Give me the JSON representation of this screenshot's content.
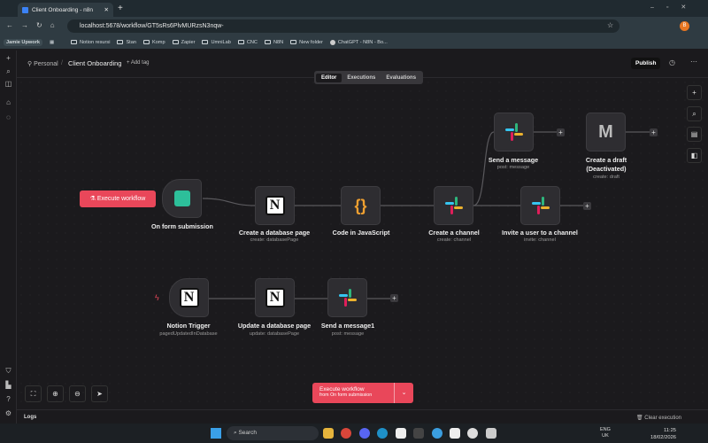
{
  "browser": {
    "tab_title": "Client Onboarding - n8n",
    "url": "localhost:5678/workflow/GT5sRs6PlvMURzsN3nqw-",
    "profile_initial": "B",
    "bookmarks": [
      "Jamie Upwork",
      "Notion resursi",
      "Stan",
      "Komp",
      "Zapier",
      "UmniLab",
      "CNC",
      "N8N",
      "New folder",
      "ChatGPT - N8N - Bo..."
    ]
  },
  "header": {
    "project": "Personal",
    "workflow_name": "Client Onboarding",
    "add_tag": "+ Add tag",
    "publish": "Publish"
  },
  "tabs": [
    "Editor",
    "Executions",
    "Evaluations"
  ],
  "execute_small": "Execute workflow",
  "nodes": [
    {
      "title": "On form submission",
      "sub": ""
    },
    {
      "title": "Create a database page",
      "sub": "create: databasePage"
    },
    {
      "title": "Code in JavaScript",
      "sub": ""
    },
    {
      "title": "Create a channel",
      "sub": "create: channel"
    },
    {
      "title": "Send a message",
      "sub": "post: message"
    },
    {
      "title": "Create a draft",
      "title2": "(Deactivated)",
      "sub": "create: draft"
    },
    {
      "title": "Invite a user to a channel",
      "sub": "invite: channel"
    },
    {
      "title": "Notion Trigger",
      "sub": "pagedUpdatedInDatabase"
    },
    {
      "title": "Update a database page",
      "sub": "update: databasePage"
    },
    {
      "title": "Send a message1",
      "sub": "post: message"
    }
  ],
  "execute_main": {
    "label": "Execute workflow",
    "sub": "from On form submission"
  },
  "logs": {
    "label": "Logs",
    "clear": "Clear execution"
  },
  "taskbar": {
    "search": "Search",
    "lang": "ENG",
    "region": "UK",
    "time": "11:25",
    "date": "18/02/2026"
  },
  "colors": {
    "accent": "#e9475a",
    "bg": "#1b1a1d"
  }
}
